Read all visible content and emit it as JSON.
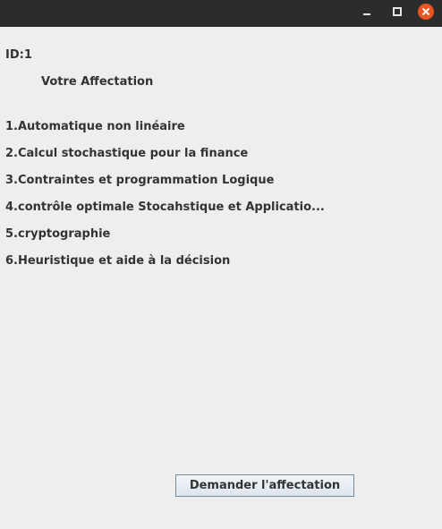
{
  "window": {
    "controls": {
      "minimize_icon": "minimize-icon",
      "maximize_icon": "maximize-icon",
      "close_icon": "close-icon",
      "close_color": "#e95420"
    }
  },
  "form": {
    "id_label": "ID:1",
    "heading": "Votre Affectation",
    "courses": [
      "1.Automatique non linéaire",
      "2.Calcul stochastique pour la finance",
      "3.Contraintes et programmation Logique",
      "4.contrôle optimale Stocahstique et Applicatio...",
      "5.cryptographie",
      "6.Heuristique et aide à la décision"
    ],
    "request_button": "Demander l'affectation"
  }
}
